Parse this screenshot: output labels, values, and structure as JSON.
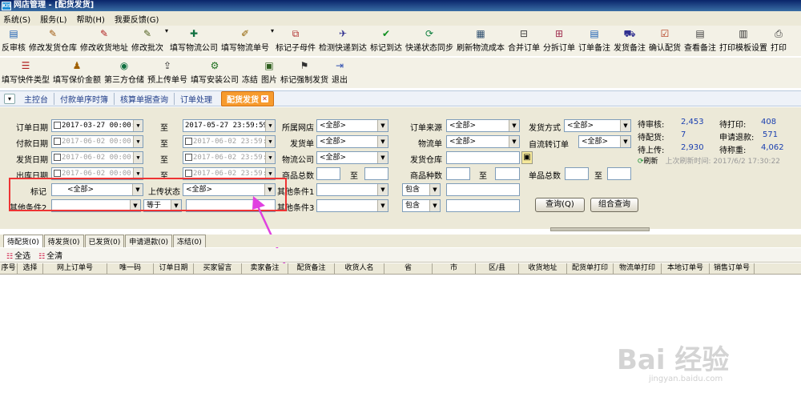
{
  "window": {
    "title": "网店管理 - [配货发货]",
    "app_icon": "KIS"
  },
  "menu": [
    "系统(S)",
    "服务(L)",
    "帮助(H)",
    "我要反馈(G)"
  ],
  "toolbar1": [
    {
      "label": "反审核",
      "icon": "unapprove-icon",
      "glyph": "▤",
      "color": "#1a5fb4"
    },
    {
      "label": "修改发货仓库",
      "icon": "warehouse-edit-icon",
      "glyph": "✎",
      "color": "#a05a10"
    },
    {
      "label": "修改收货地址",
      "icon": "address-edit-icon",
      "glyph": "✎",
      "color": "#b02020"
    },
    {
      "label": "修改批次",
      "icon": "batch-edit-icon",
      "glyph": "✎",
      "color": "#506020"
    },
    {
      "label": "填写物流公司",
      "icon": "logistics-company-icon",
      "glyph": "✚",
      "color": "#107040"
    },
    {
      "label": "填写物流单号",
      "icon": "tracking-number-icon",
      "glyph": "✐",
      "color": "#906000"
    },
    {
      "label": "标记子母件",
      "icon": "parent-child-icon",
      "glyph": "⧉",
      "color": "#b03030"
    },
    {
      "label": "检测快递到达",
      "icon": "detect-arrival-icon",
      "glyph": "✈",
      "color": "#303090"
    },
    {
      "label": "标记到达",
      "icon": "mark-arrived-icon",
      "glyph": "✔",
      "color": "#109020"
    },
    {
      "label": "快递状态同步",
      "icon": "sync-status-icon",
      "glyph": "⟳",
      "color": "#108040"
    },
    {
      "label": "刷新物流成本",
      "icon": "refresh-cost-icon",
      "glyph": "▦",
      "color": "#305070"
    },
    {
      "label": "合并订单",
      "icon": "merge-order-icon",
      "glyph": "⊟",
      "color": "#404040"
    },
    {
      "label": "分拆订单",
      "icon": "split-order-icon",
      "glyph": "⊞",
      "color": "#a03050"
    },
    {
      "label": "订单备注",
      "icon": "order-note-icon",
      "glyph": "▤",
      "color": "#1a5fb4"
    },
    {
      "label": "发货备注",
      "icon": "ship-note-icon",
      "glyph": "⛟",
      "color": "#303090"
    },
    {
      "label": "确认配货",
      "icon": "confirm-allocation-icon",
      "glyph": "☑",
      "color": "#b03010"
    },
    {
      "label": "查看备注",
      "icon": "view-note-icon",
      "glyph": "▤",
      "color": "#404040"
    },
    {
      "label": "打印模板设置",
      "icon": "print-template-icon",
      "glyph": "▥",
      "color": "#303030"
    },
    {
      "label": "打印",
      "icon": "print-icon",
      "glyph": "⎙",
      "color": "#303030"
    }
  ],
  "toolbar2": [
    {
      "label": "填写快件类型",
      "icon": "express-type-icon",
      "glyph": "☰",
      "color": "#b02020"
    },
    {
      "label": "填写保价金额",
      "icon": "insured-amount-icon",
      "glyph": "♟",
      "color": "#a06000"
    },
    {
      "label": "第三方仓储",
      "icon": "third-party-storage-icon",
      "glyph": "◉",
      "color": "#107040"
    },
    {
      "label": "预上传单号",
      "icon": "pre-upload-icon",
      "glyph": "⇪",
      "color": "#303030"
    },
    {
      "label": "填写安装公司",
      "icon": "install-company-icon",
      "glyph": "⚙",
      "color": "#207020"
    },
    {
      "label": "冻结",
      "icon": "freeze-icon",
      "glyph": "",
      "color": "#303030"
    },
    {
      "label": "图片",
      "icon": "picture-icon",
      "glyph": "▣",
      "color": "#306020"
    },
    {
      "label": "标记强制发货",
      "icon": "force-ship-icon",
      "glyph": "⚑",
      "color": "#303030"
    },
    {
      "label": "退出",
      "icon": "exit-icon",
      "glyph": "⇥",
      "color": "#3050b0"
    }
  ],
  "nav_tabs": [
    "主控台",
    "付款单序时簿",
    "核算单据查询",
    "订单处理",
    "配货发货"
  ],
  "filters": {
    "order_date_label": "订单日期",
    "order_date_from": "2017-03-27 00:00:00",
    "to": "至",
    "order_date_to": "2017-05-27 23:59:59",
    "pay_date_label": "付款日期",
    "pay_date_from": "2017-06-02 00:00:00",
    "pay_date_to": "2017-06-02 23:59:59",
    "ship_date_label": "发货日期",
    "ship_date_from": "2017-06-02 00:00:00",
    "ship_date_to": "2017-06-02 23:59:59",
    "out_date_label": "出库日期",
    "out_date_from": "2017-06-02 00:00:00",
    "out_date_to": "2017-06-02 23:59:59",
    "mark_label": "标记",
    "mark_value": "<全部>",
    "upload_label": "上传状态",
    "upload_value": "<全部>",
    "other2_label": "其他条件2",
    "other2_value": "",
    "other2_op": "等于",
    "other2_input": "",
    "shop_label": "所属网店",
    "shop_value": "<全部>",
    "waybill_label": "发货单",
    "waybill_value": "<全部>",
    "logistics_label": "物流公司",
    "logistics_value": "<全部>",
    "goods_total_label": "商品总数",
    "goods_to": "至",
    "other1_label": "其他条件1",
    "other1_value": "",
    "other1_op": "包含",
    "other1_input": "",
    "other3_label": "其他条件3",
    "other3_value": "",
    "other3_op": "包含",
    "other3_input": "",
    "order_source_label": "订单来源",
    "order_source_value": "<全部>",
    "logistics_doc_label": "物流单",
    "logistics_doc_value": "<全部>",
    "ship_wh_label": "发货仓库",
    "ship_wh_value": "",
    "goods_kinds_label": "商品种数",
    "kinds_to": "至",
    "ship_method_label": "发货方式",
    "ship_method_value": "<全部>",
    "auto_transfer_label": "自流转订单",
    "auto_transfer_value": "<全部>",
    "single_total_label": "单品总数",
    "single_to": "至",
    "query_button": "查询(Q)",
    "combo_query_button": "组合查询"
  },
  "stats": {
    "pending_review_label": "待审核:",
    "pending_review": "2,453",
    "pending_print_label": "待打印:",
    "pending_print": "408",
    "pending_alloc_label": "待配货:",
    "pending_alloc": "7",
    "refund_label": "申请退款:",
    "refund": "571",
    "pending_upload_label": "待上传:",
    "pending_upload": "2,930",
    "pending_weigh_label": "待称重:",
    "pending_weigh": "4,062",
    "refresh_label": "刷新",
    "last_refresh": "上次刷新时间: 2017/6/2 17:30:22"
  },
  "sub_tabs": [
    "待配货(0)",
    "待发货(0)",
    "已发货(0)",
    "申请退款(0)",
    "冻结(0)"
  ],
  "actions": [
    "全选",
    "全清"
  ],
  "columns": [
    "序号",
    "选择",
    "网上订单号",
    "唯一码",
    "订单日期",
    "买家留言",
    "卖家备注",
    "配货备注",
    "收货人名",
    "省",
    "市",
    "区/县",
    "收货地址",
    "配货单打印",
    "物流单打印",
    "本地订单号",
    "销售订单号"
  ],
  "watermark": {
    "text": "Bai 经验",
    "url": "jingyan.baidu.com"
  },
  "colors": {
    "title_bar": "#0a246a",
    "active_tab": "#f79b2e",
    "highlight_box": "#e33333",
    "arrow": "#e040e0",
    "stat_numbers": "#1a3fb0"
  }
}
